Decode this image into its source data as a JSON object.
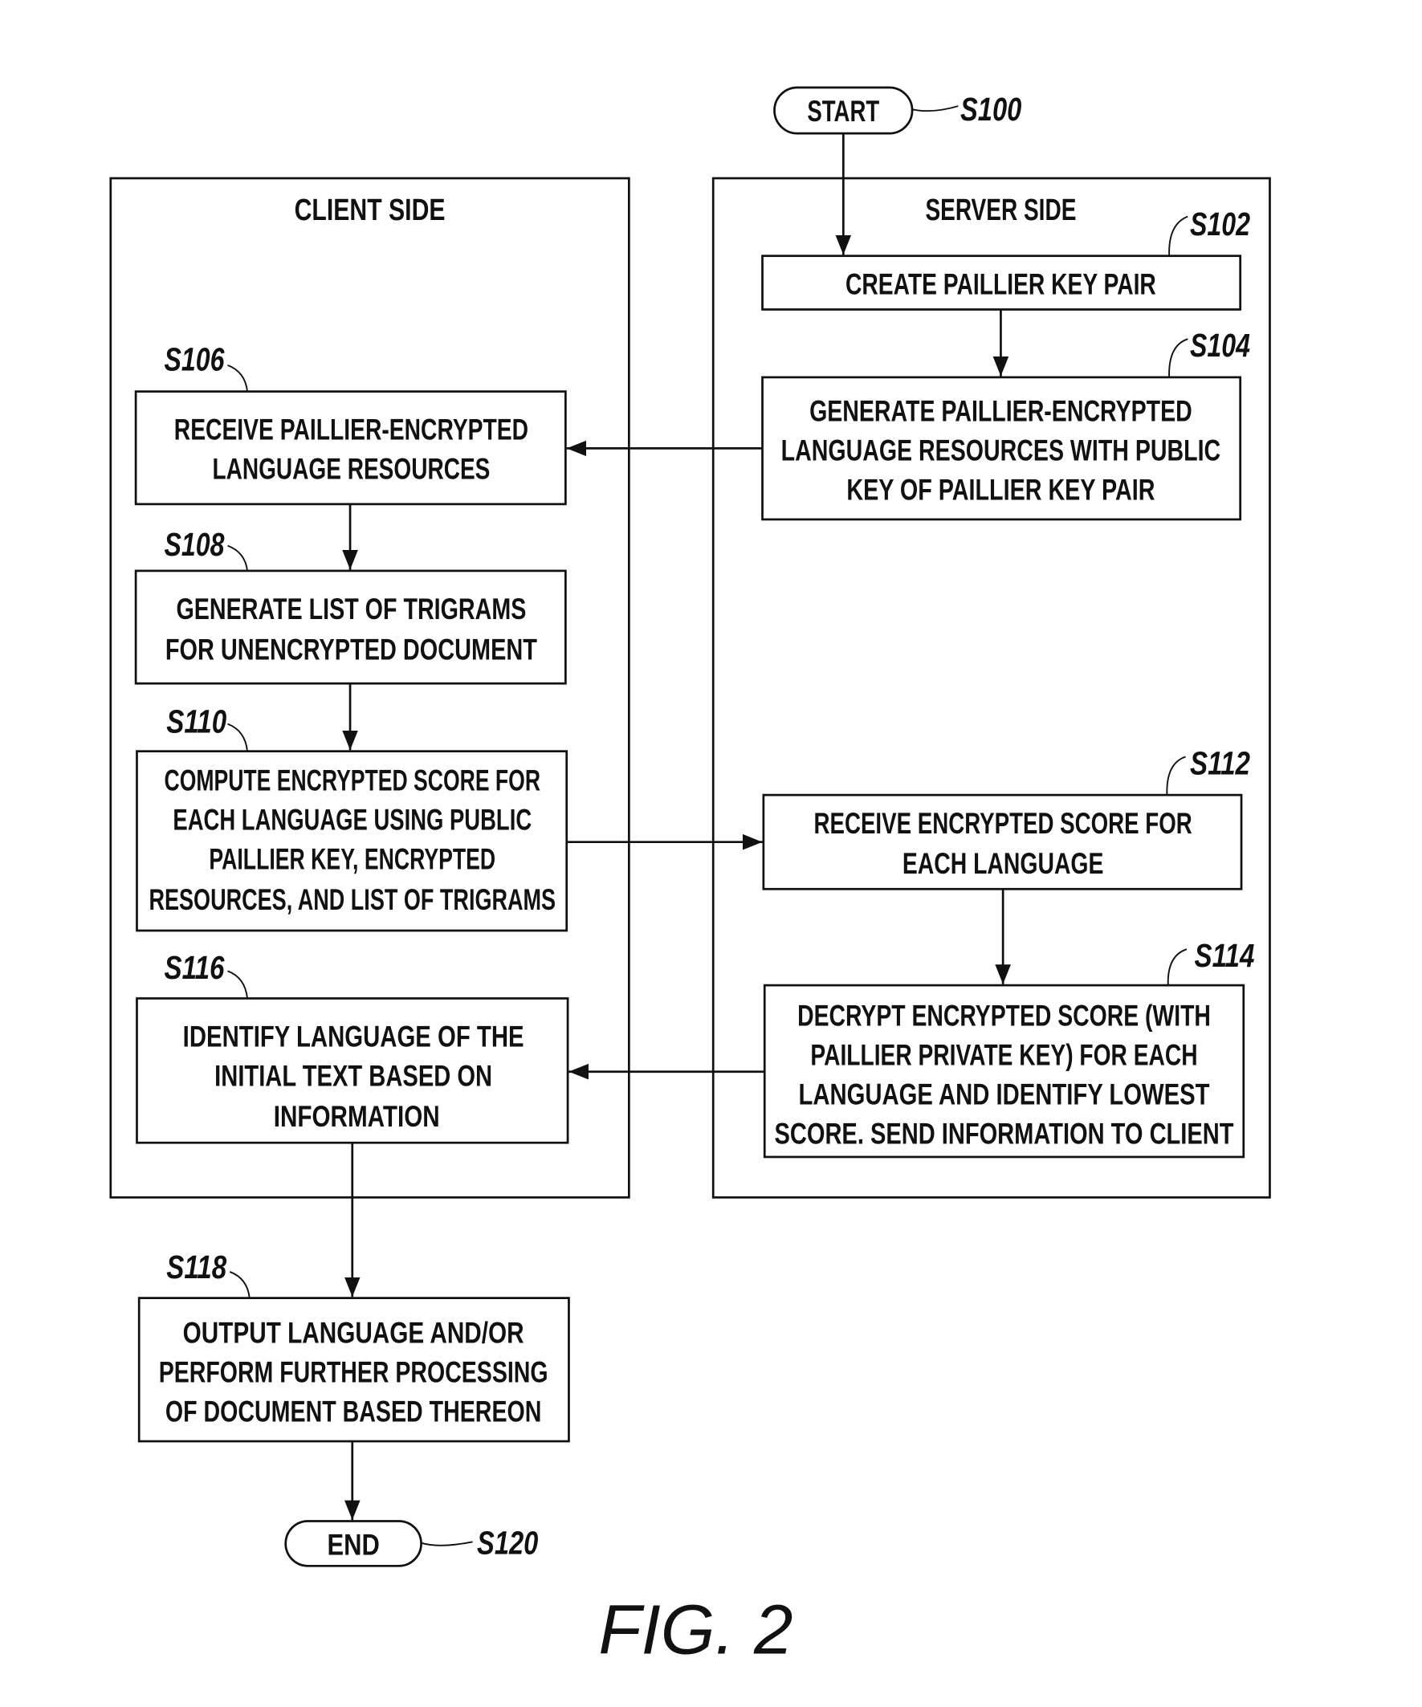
{
  "figure_label": "FIG. 2",
  "regions": {
    "client": "CLIENT  SIDE",
    "server": "SERVER SIDE"
  },
  "terminals": {
    "start": {
      "label": "START",
      "ref": "S100"
    },
    "end": {
      "label": "END",
      "ref": "S120"
    }
  },
  "steps": {
    "s102": {
      "ref": "S102",
      "lines": [
        "CREATE PAILLIER KEY PAIR"
      ]
    },
    "s104": {
      "ref": "S104",
      "lines": [
        "GENERATE PAILLIER-ENCRYPTED",
        "LANGUAGE RESOURCES WITH PUBLIC",
        "KEY OF PAILLIER KEY PAIR"
      ]
    },
    "s106": {
      "ref": "S106",
      "lines": [
        "RECEIVE PAILLIER-ENCRYPTED",
        "LANGUAGE RESOURCES"
      ]
    },
    "s108": {
      "ref": "S108",
      "lines": [
        "GENERATE LIST OF TRIGRAMS",
        "FOR UNENCRYPTED DOCUMENT"
      ]
    },
    "s110": {
      "ref": "S110",
      "lines": [
        "COMPUTE ENCRYPTED SCORE FOR",
        "EACH LANGUAGE USING PUBLIC",
        "PAILLIER KEY, ENCRYPTED",
        "RESOURCES, AND LIST OF TRIGRAMS"
      ]
    },
    "s112": {
      "ref": "S112",
      "lines": [
        "RECEIVE ENCRYPTED SCORE FOR",
        "EACH LANGUAGE"
      ]
    },
    "s114": {
      "ref": "S114",
      "lines": [
        "DECRYPT ENCRYPTED SCORE (WITH",
        "PAILLIER PRIVATE KEY) FOR EACH",
        "LANGUAGE AND IDENTIFY LOWEST",
        "SCORE. SEND INFORMATION TO CLIENT"
      ]
    },
    "s116": {
      "ref": "S116",
      "lines": [
        "IDENTIFY LANGUAGE OF THE",
        "INITIAL TEXT BASED ON",
        "INFORMATION"
      ]
    },
    "s118": {
      "ref": "S118",
      "lines": [
        "OUTPUT LANGUAGE AND/OR",
        "PERFORM FURTHER PROCESSING",
        "OF DOCUMENT BASED THEREON"
      ]
    }
  }
}
